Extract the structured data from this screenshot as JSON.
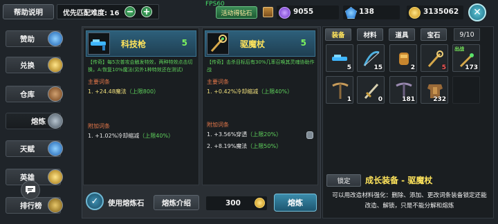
{
  "top_bar": {
    "help_label": "帮助说明",
    "difficulty_label": "优先匹配难度: 16",
    "fps": "FPS60",
    "event_label": "活动得钻石",
    "purple_gems": "9055",
    "blue_gems": "138",
    "gold": "3135062"
  },
  "sidebar": {
    "items": [
      {
        "label": "赞助"
      },
      {
        "label": "兑换"
      },
      {
        "label": "仓库"
      },
      {
        "label": "熔炼"
      },
      {
        "label": "天赋"
      },
      {
        "label": "英雄"
      },
      {
        "label": "排行榜"
      }
    ]
  },
  "cards": [
    {
      "title": "科技枪",
      "level": "5",
      "desc": "【传奇】每5次普攻会触发特效，两种特效点击切换，A:恢复10%魔法(另外1种特效还在测试)",
      "main_title": "主要词条",
      "main_stat": "1. +24.48魔法",
      "main_limit": "（上限800）",
      "extra_title": "附加词条",
      "extra_stats": [
        {
          "text": "1. +1.02%冷却缩减",
          "limit": "（上限40%）"
        }
      ]
    },
    {
      "title": "驱魔杖",
      "level": "5",
      "desc": "【传奇】击杀目标后有30%几率召唤其灵魂协助作战",
      "main_title": "主要词条",
      "main_stat": "1. +0.42%冷却缩减",
      "main_limit": "（上限40%）",
      "extra_title": "附加词条",
      "extra_stats": [
        {
          "text": "1. +3.56%穿透",
          "limit": "（上限20%）"
        },
        {
          "text": "2. +8.19%魔法",
          "limit": "（上限50%）"
        }
      ]
    }
  ],
  "bottom": {
    "use_stone_label": "使用熔炼石",
    "intro_label": "熔炼介绍",
    "cost": "300",
    "smelt_label": "熔炼"
  },
  "inventory": {
    "tabs": [
      {
        "label": "装备"
      },
      {
        "label": "材料"
      },
      {
        "label": "道具"
      },
      {
        "label": "宝石"
      }
    ],
    "count": "9/10",
    "slots": [
      {
        "count": "5",
        "equipped": "",
        "icon": "blue-gun-icon"
      },
      {
        "count": "15",
        "equipped": "",
        "icon": "bow-icon"
      },
      {
        "count": "2",
        "equipped": "",
        "icon": "gauntlet-icon"
      },
      {
        "count": "5",
        "equipped": "",
        "icon": "staff-icon"
      },
      {
        "count": "173",
        "equipped": "出战",
        "icon": "weapon-icon"
      },
      {
        "count": "1",
        "equipped": "",
        "icon": "crossbow-icon"
      },
      {
        "count": "0",
        "equipped": "",
        "icon": "sword-icon"
      },
      {
        "count": "181",
        "equipped": "",
        "icon": "crossbow-icon"
      },
      {
        "count": "232",
        "equipped": "",
        "icon": "armor-icon"
      },
      {
        "count": "",
        "equipped": "",
        "icon": ""
      }
    ],
    "lock_label": "锁定",
    "grow_title": "成长装备 - 驱魔杖",
    "grow_desc": "可以用改造材料强化：删除、添加、更改词条装备锁定还能改造、解锁，只是不能分解和熔炼"
  },
  "colors": {
    "accent_yellow": "#ffe45c",
    "accent_green": "#7cf15e",
    "stat_yellow": "#f1e07c",
    "section_orange": "#e7784a"
  }
}
